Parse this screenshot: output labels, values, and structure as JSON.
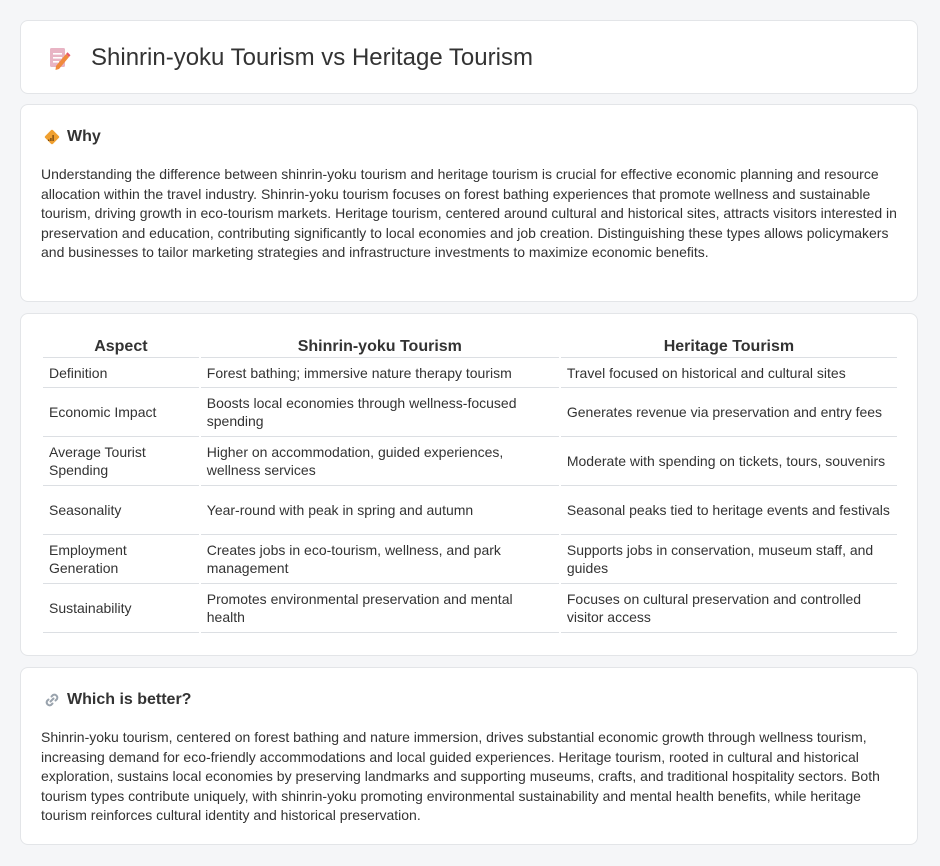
{
  "header": {
    "title": "Shinrin-yoku Tourism vs Heritage Tourism",
    "icon": "document-pencil-icon"
  },
  "why": {
    "heading": "Why",
    "icon": "diamond-signal-icon",
    "body": "Understanding the difference between shinrin-yoku tourism and heritage tourism is crucial for effective economic planning and resource allocation within the travel industry. Shinrin-yoku tourism focuses on forest bathing experiences that promote wellness and sustainable tourism, driving growth in eco-tourism markets. Heritage tourism, centered around cultural and historical sites, attracts visitors interested in preservation and education, contributing significantly to local economies and job creation. Distinguishing these types allows policymakers and businesses to tailor marketing strategies and infrastructure investments to maximize economic benefits."
  },
  "comparison": {
    "headers": [
      "Aspect",
      "Shinrin-yoku Tourism",
      "Heritage Tourism"
    ],
    "rows": [
      [
        "Definition",
        "Forest bathing; immersive nature therapy tourism",
        "Travel focused on historical and cultural sites"
      ],
      [
        "Economic Impact",
        "Boosts local economies through wellness-focused spending",
        "Generates revenue via preservation and entry fees"
      ],
      [
        "Average Tourist Spending",
        "Higher on accommodation, guided experiences, wellness services",
        "Moderate with spending on tickets, tours, souvenirs"
      ],
      [
        "Seasonality",
        "Year-round with peak in spring and autumn",
        "Seasonal peaks tied to heritage events and festivals"
      ],
      [
        "Employment Generation",
        "Creates jobs in eco-tourism, wellness, and park management",
        "Supports jobs in conservation, museum staff, and guides"
      ],
      [
        "Sustainability",
        "Promotes environmental preservation and mental health",
        "Focuses on cultural preservation and controlled visitor access"
      ]
    ]
  },
  "better": {
    "heading": "Which is better?",
    "icon": "link-icon",
    "body": "Shinrin-yoku tourism, centered on forest bathing and nature immersion, drives substantial economic growth through wellness tourism, increasing demand for eco-friendly accommodations and local guided experiences. Heritage tourism, rooted in cultural and historical exploration, sustains local economies by preserving landmarks and supporting museums, crafts, and traditional hospitality sectors. Both tourism types contribute uniquely, with shinrin-yoku promoting environmental sustainability and mental health benefits, while heritage tourism reinforces cultural identity and historical preservation."
  },
  "colors": {
    "background": "#f5f6f8",
    "card": "#ffffff",
    "border": "#e3e5e8",
    "icon_orange": "#f0a030",
    "icon_pink": "#e8839a"
  }
}
